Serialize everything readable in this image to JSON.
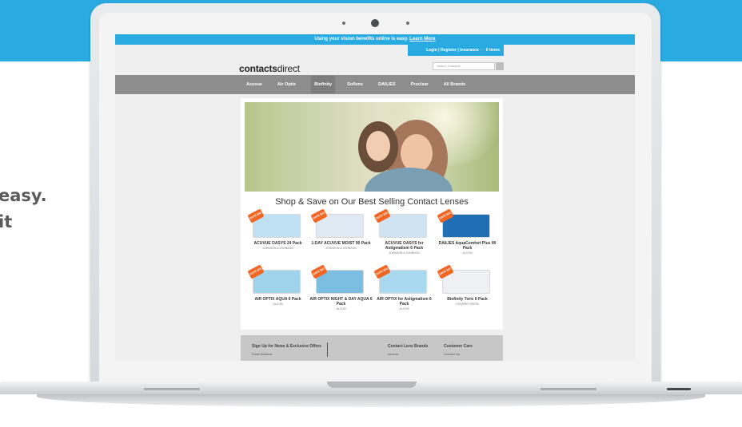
{
  "side_text": {
    "line1": "easy.",
    "line2": "it"
  },
  "banner": {
    "text": "Using your vision benefits online is easy.",
    "link": "Learn More"
  },
  "account": {
    "login": "Login",
    "register": "Register",
    "insurance": "Insurance",
    "cart": "0 items"
  },
  "logo": {
    "bold": "contacts",
    "light": "direct"
  },
  "search": {
    "placeholder": "Search Contacts"
  },
  "nav": [
    "Acuvue",
    "Air Optix",
    "Biofinity",
    "Soflens",
    "DAILIES",
    "Proclear",
    "All Brands"
  ],
  "promo_heading": "Shop & Save on Our Best Selling Contact Lenses",
  "sale_badge": "SAVE BIG",
  "products": [
    {
      "name": "ACUVUE OASYS 24 Pack",
      "brand": "JOHNSON & JOHNSON",
      "color": "#bfe0f3"
    },
    {
      "name": "1-DAY ACUVUE MOIST 90 Pack",
      "brand": "JOHNSON & JOHNSON",
      "color": "#dfe9f3"
    },
    {
      "name": "ACUVUE OASYS for Astigmatism 6 Pack",
      "brand": "JOHNSON & JOHNSON",
      "color": "#cfe4f2"
    },
    {
      "name": "DAILIES AquaComfort Plus 90 Pack",
      "brand": "ALCON",
      "color": "#1f6fb4"
    },
    {
      "name": "AIR OPTIX AQUA 6 Pack",
      "brand": "ALCON",
      "color": "#9fd3ec"
    },
    {
      "name": "AIR OPTIX NIGHT & DAY AQUA 6 Pack",
      "brand": "ALCON",
      "color": "#7cbde2"
    },
    {
      "name": "AIR OPTIX for Astigmatism 6 Pack",
      "brand": "ALCON",
      "color": "#a9d9ee"
    },
    {
      "name": "Biofinity Toric 6 Pack",
      "brand": "COOPER VISION",
      "color": "#eef0f3"
    }
  ],
  "footer": {
    "newsletter": "Sign Up for News & Exclusive Offers",
    "email_label": "Email Address",
    "brands": "Contact Lens Brands",
    "brand_link": "Acuvue",
    "care": "Customer Care",
    "care_link": "Contact Us"
  }
}
